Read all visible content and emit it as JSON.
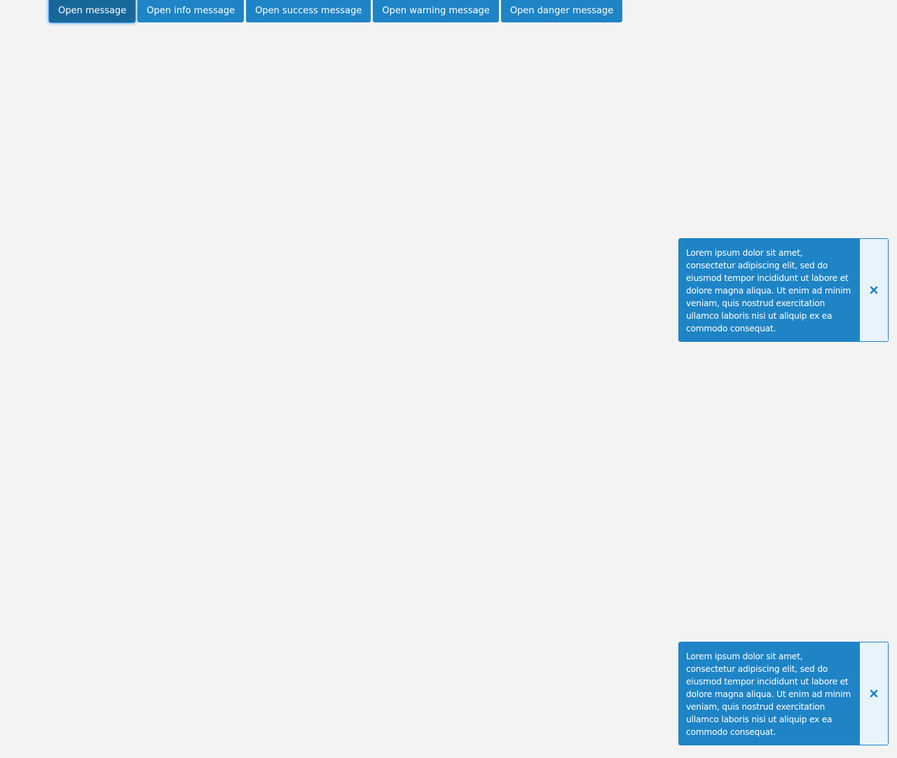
{
  "toolbar": {
    "buttons": [
      {
        "label": "Open message",
        "active": true
      },
      {
        "label": "Open info message"
      },
      {
        "label": "Open success message"
      },
      {
        "label": "Open warning message"
      },
      {
        "label": "Open danger message"
      }
    ]
  },
  "toasts": [
    {
      "text": "Lorem ipsum dolor sit amet, consectetur adipiscing elit, sed do eiusmod tempor incididunt ut labore et dolore magna aliqua. Ut enim ad minim veniam, quis nostrud exercitation ullamco laboris nisi ut aliquip ex ea commodo consequat.",
      "close_icon": "close-icon"
    },
    {
      "text": "Lorem ipsum dolor sit amet, consectetur adipiscing elit, sed do eiusmod tempor incididunt ut labore et dolore magna aliqua. Ut enim ad minim veniam, quis nostrud exercitation ullamco laboris nisi ut aliquip ex ea commodo consequat.",
      "close_icon": "close-icon"
    }
  ],
  "colors": {
    "background": "#f3f3f3",
    "accent": "#1e84c6",
    "accent_active": "#17679b",
    "close_panel": "#e8f3fb"
  }
}
